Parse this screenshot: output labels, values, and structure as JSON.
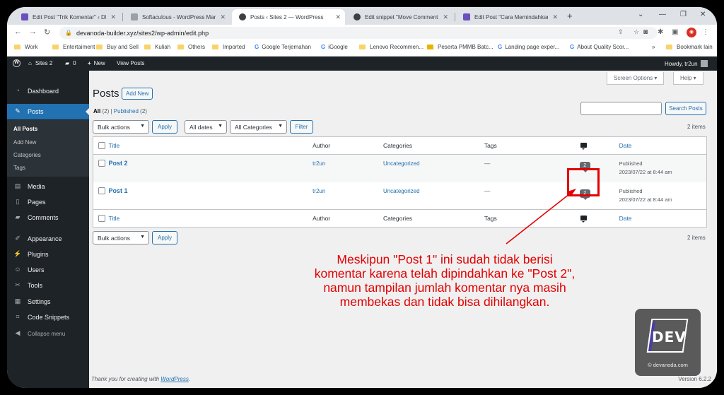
{
  "browser": {
    "tabs": [
      {
        "title": "Edit Post \"Trik Komentar\" ‹ DEVan",
        "fav": "#6a4fbf"
      },
      {
        "title": "Softaculous - WordPress Manage",
        "fav": "#9aa0a6"
      },
      {
        "title": "Posts ‹ Sites 2 — WordPress",
        "fav": "#3c4043"
      },
      {
        "title": "Edit snippet \"Move Comments\" ‹",
        "fav": "#3c4043"
      },
      {
        "title": "Edit Post \"Cara Memindahkan da",
        "fav": "#6a4fbf"
      }
    ],
    "new_tab": "+",
    "url": "devanoda-builder.xyz/sites2/wp-admin/edit.php",
    "bookmarks": [
      "Work",
      "Entertaiment",
      "Buy and Sell",
      "Kuliah",
      "Others",
      "Imported",
      "Google Terjemahan",
      "iGoogle",
      "Lenovo Recommen...",
      "Peserta PMMB Batc...",
      "Landing page exper...",
      "About Quality Scor...",
      "»",
      "Bookmark lain"
    ]
  },
  "adminbar": {
    "site": "Sites 2",
    "comments_count": "0",
    "new": "New",
    "view_posts": "View Posts",
    "howdy": "Howdy, tr2un"
  },
  "menu": {
    "dashboard": "Dashboard",
    "posts": "Posts",
    "sub": [
      "All Posts",
      "Add New",
      "Categories",
      "Tags"
    ],
    "media": "Media",
    "pages": "Pages",
    "comments": "Comments",
    "appearance": "Appearance",
    "plugins": "Plugins",
    "users": "Users",
    "tools": "Tools",
    "settings": "Settings",
    "code_snippets": "Code Snippets",
    "collapse": "Collapse menu"
  },
  "page": {
    "title": "Posts",
    "add_new": "Add New",
    "screen_options": "Screen Options ▾",
    "help": "Help ▾",
    "view_all": "All",
    "view_all_count": "(2)",
    "view_sep": "|",
    "view_published": "Published",
    "view_published_count": "(2)",
    "search_button": "Search Posts",
    "bulk_actions": "Bulk actions",
    "apply": "Apply",
    "all_dates": "All dates",
    "all_categories": "All Categories",
    "filter": "Filter",
    "items_count": "2 items"
  },
  "table": {
    "columns": {
      "title": "Title",
      "author": "Author",
      "categories": "Categories",
      "tags": "Tags",
      "date": "Date"
    },
    "rows": [
      {
        "title": "Post 2",
        "author": "tr2un",
        "category": "Uncategorized",
        "tags": "—",
        "comments": "2",
        "status": "Published",
        "date": "2023/07/22 at 8:44 am"
      },
      {
        "title": "Post 1",
        "author": "tr2un",
        "category": "Uncategorized",
        "tags": "—",
        "comments": "2",
        "status": "Published",
        "date": "2023/07/22 at 8:44 am"
      }
    ]
  },
  "footer": {
    "thanks_prefix": "Thank you for creating with ",
    "thanks_link": "WordPress",
    "thanks_suffix": ".",
    "version": "Version 6.2.2"
  },
  "annotation": {
    "lines": [
      "Meskipun \"Post 1\" ini sudah tidak berisi",
      "komentar karena telah dipindahkan ke \"Post 2\",",
      "namun tampilan jumlah komentar nya masih",
      "membekas dan tidak bisa dihilangkan."
    ],
    "color": "#e30000"
  },
  "logo": {
    "word": "DEV",
    "caption": "© devanoda.com"
  },
  "colors": {
    "wp_blue": "#2271b1",
    "admin_dark": "#1d2327"
  }
}
